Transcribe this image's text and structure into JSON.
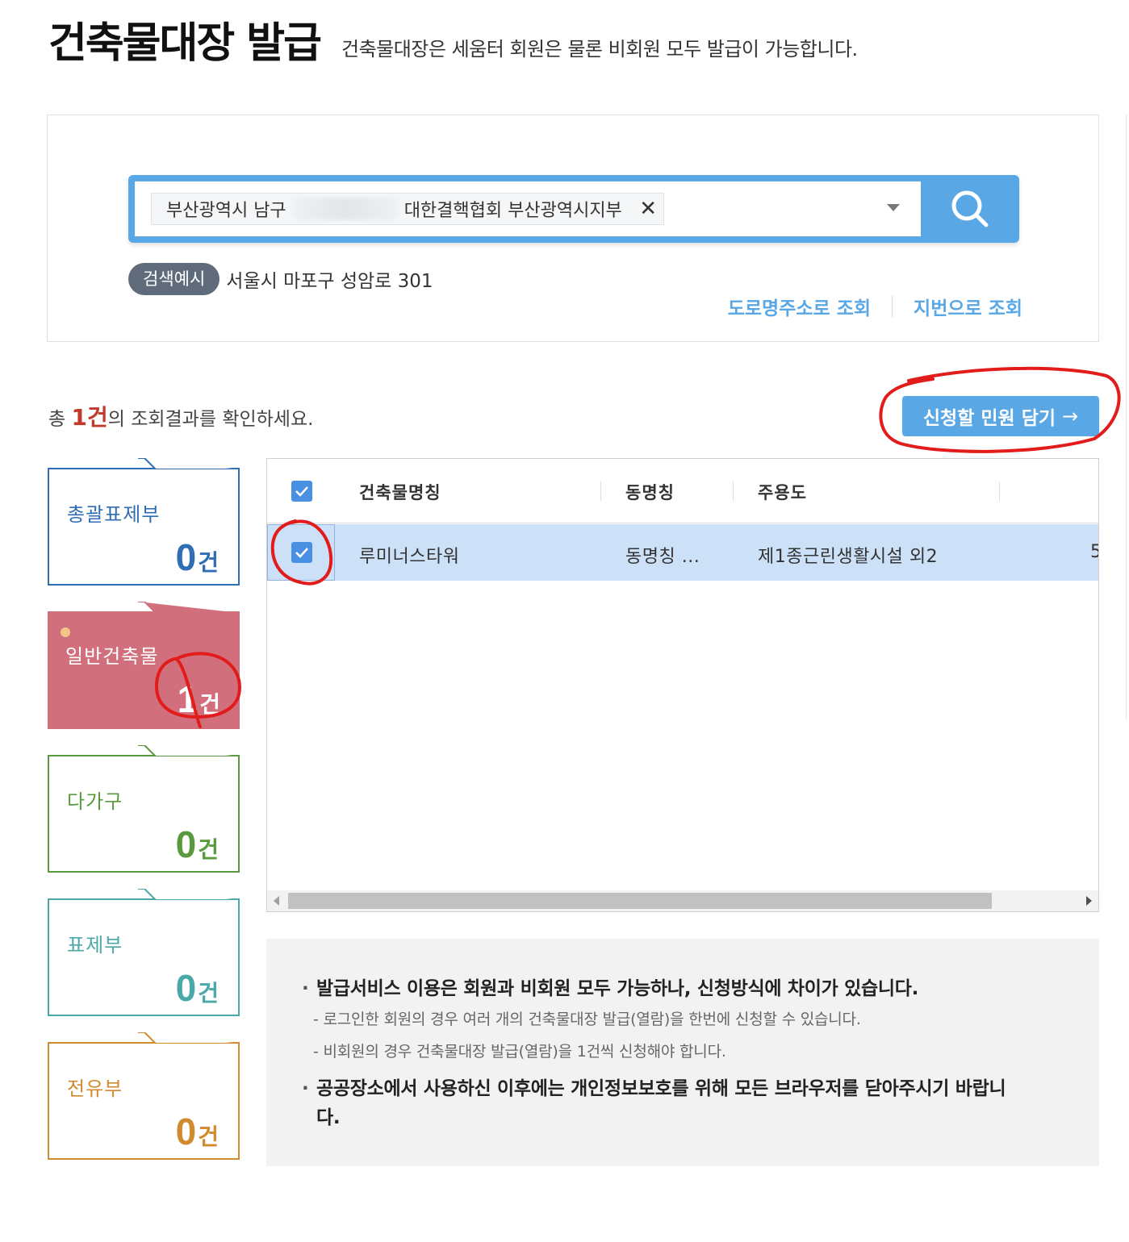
{
  "header": {
    "title": "건축물대장 발급",
    "subtitle": "건축물대장은 세움터 회원은 물론 비회원 모두 발급이 가능합니다."
  },
  "search": {
    "chip_prefix": "부산광역시 남구",
    "chip_suffix": "대한결핵협회 부산광역시지부",
    "chip_close": "✕",
    "example_badge": "검색예시",
    "example_text": "서울시 마포구 성암로 301",
    "road_lookup": "도로명주소로 조회",
    "lot_lookup": "지번으로 조회",
    "accent": "#5aa7e6"
  },
  "results": {
    "prefix": "총 ",
    "count": "1건",
    "suffix": "의 조회결과를 확인하세요.",
    "add_button": "신청할 민원 담기",
    "add_arrow": "→"
  },
  "categories": [
    {
      "label": "총괄표제부",
      "num": "0",
      "unit": "건",
      "color": "#2f6db5",
      "active": false
    },
    {
      "label": "일반건축물",
      "num": "1",
      "unit": "건",
      "color": "#ffffff",
      "bg": "#d1707c",
      "active": true
    },
    {
      "label": "다가구",
      "num": "0",
      "unit": "건",
      "color": "#5a9a3e",
      "active": false
    },
    {
      "label": "표제부",
      "num": "0",
      "unit": "건",
      "color": "#4aa9a8",
      "active": false
    },
    {
      "label": "전유부",
      "num": "0",
      "unit": "건",
      "color": "#d28a2e",
      "active": false
    }
  ],
  "grid": {
    "columns": [
      "건축물명칭",
      "동명칭",
      "주용도"
    ],
    "rows": [
      {
        "name": "루미너스타워",
        "dong": "동명칭 ...",
        "use": "제1종근린생활시설 외2",
        "extra": "5",
        "checked": true
      }
    ]
  },
  "notice": {
    "item1": "발급서비스 이용은 회원과 비회원 모두 가능하나, 신청방식에 차이가 있습니다.",
    "item1_sub1": "- 로그인한 회원의 경우 여러 개의 건축물대장 발급(열람)을 한번에 신청할 수 있습니다.",
    "item1_sub2": "- 비회원의 경우 건축물대장 발급(열람)을 1건씩 신청해야 합니다.",
    "item2": "공공장소에서 사용하신 이후에는 개인정보보호를 위해 모든 브라우저를 닫아주시기 바랍니다."
  }
}
